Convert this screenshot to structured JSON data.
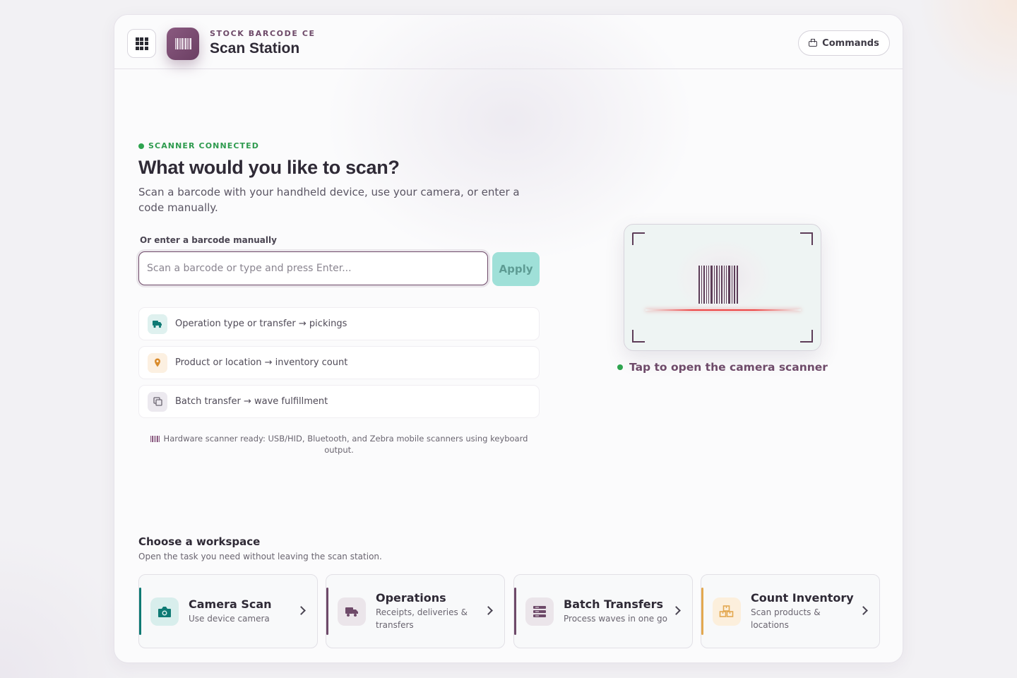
{
  "header": {
    "kicker": "STOCK BARCODE CE",
    "title": "Scan Station",
    "commands_label": "Commands",
    "apps_icon": "apps-grid-icon",
    "logo_icon": "barcode-icon"
  },
  "scanner": {
    "status": "SCANNER CONNECTED",
    "headline": "What would you like to scan?",
    "subtitle": "Scan a barcode with your handheld device, use your camera, or enter a code manually.",
    "manual_label": "Or enter a barcode manually",
    "input_value": "",
    "input_placeholder": "Scan a barcode or type and press Enter...",
    "apply_label": "Apply",
    "hints": [
      {
        "icon": "truck-icon",
        "text": "Operation type or transfer → pickings",
        "color": "#0f7a74",
        "bg": "#dff1ef"
      },
      {
        "icon": "map-pin-icon",
        "text": "Product or location → inventory count",
        "color": "#d98b2b",
        "bg": "#fcf0e1"
      },
      {
        "icon": "copy-icon",
        "text": "Batch transfer → wave fulfillment",
        "color": "#6a6570",
        "bg": "#ece9ef"
      }
    ],
    "hardware_note": "Hardware scanner ready: USB/HID, Bluetooth, and Zebra mobile scanners using keyboard output."
  },
  "camera": {
    "caption": "Tap to open the camera scanner"
  },
  "workspace": {
    "title": "Choose a workspace",
    "subtitle": "Open the task you need without leaving the scan station.",
    "cards": [
      {
        "name": "Camera Scan",
        "desc": "Use device camera",
        "icon": "camera-icon",
        "accent": "#0f7a74",
        "icon_bg": "#d8eeec"
      },
      {
        "name": "Operations",
        "desc": "Receipts, deliveries & transfers",
        "icon": "truck-icon",
        "accent": "#6e4a69",
        "icon_bg": "#ebe5ea"
      },
      {
        "name": "Batch Transfers",
        "desc": "Process waves in one go",
        "icon": "stack-icon",
        "accent": "#6e4a69",
        "icon_bg": "#ebe5ea"
      },
      {
        "name": "Count Inventory",
        "desc": "Scan products & locations",
        "icon": "boxes-icon",
        "accent": "#e3a850",
        "icon_bg": "#fcefdc"
      }
    ]
  },
  "colors": {
    "brand": "#6e4a69",
    "success": "#2ea44f",
    "teal": "#0f7a74"
  }
}
